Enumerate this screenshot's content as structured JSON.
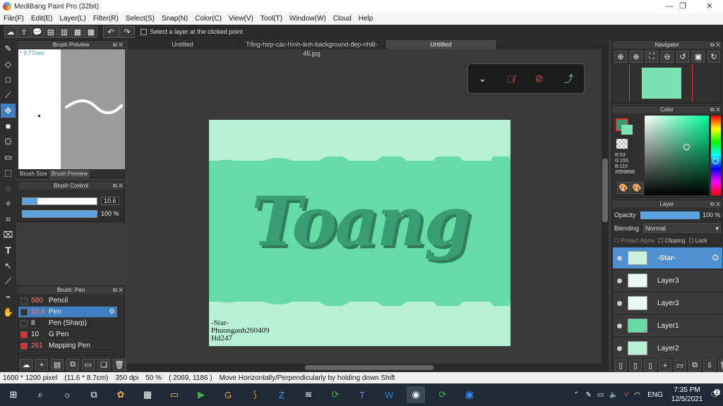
{
  "window": {
    "title": "MediBang Paint Pro (32bit)"
  },
  "menu": [
    "File(F)",
    "Edit(E)",
    "Layer(L)",
    "Filter(R)",
    "Select(S)",
    "Snap(N)",
    "Color(C)",
    "View(V)",
    "Tool(T)",
    "Window(W)",
    "Cloud",
    "Help"
  ],
  "toolbar": {
    "hint": "Select a layer at the clicked point"
  },
  "brush_preview": {
    "title": "Brush Preview",
    "size_label": "* 0.77mm",
    "tab_size": "Brush Size",
    "tab_preview": "Brush Preview"
  },
  "brush_control": {
    "title": "Brush Control",
    "size_value": "10.6",
    "opacity_value": "100 %",
    "size_fraction": 0.2,
    "opacity_fraction": 1.0
  },
  "tabs": [
    "Untitled",
    "Tổng-hợp-các-hình-ảnh-background-đẹp-nhất-45.jpg",
    "Untitled"
  ],
  "artwork": {
    "title": "Toang",
    "signature": [
      "-Star-",
      "Phuonganh260409",
      "Hd247"
    ]
  },
  "brush_list": {
    "title": "Brush: Pen",
    "items": [
      {
        "size": "580",
        "name": "Pencil",
        "swatch": "#333333",
        "highlight": false
      },
      {
        "size": "10.6",
        "name": "Pen",
        "swatch": "#333333",
        "highlight": true
      },
      {
        "size": "8",
        "name": "Pen (Sharp)",
        "swatch": "#333333",
        "highlight": false
      },
      {
        "size": "10",
        "name": "G Pen",
        "swatch": "#e03030",
        "highlight": false
      },
      {
        "size": "261",
        "name": "Mapping Pen",
        "swatch": "#e03030",
        "highlight": false
      }
    ]
  },
  "navigator": {
    "title": "Navigator"
  },
  "color_panel": {
    "title": "Color",
    "r": "R:53",
    "g": "G:155",
    "b": "B:110",
    "hex": "#359B6E",
    "current": "#359b6e"
  },
  "layer_panel": {
    "title": "Layer",
    "opacity_label": "Opacity",
    "opacity_value": "100 %",
    "blending_label": "Blending",
    "blending_value": "Normal",
    "protect_alpha": "Protect Alpha",
    "clipping": "Clipping",
    "lock": "Lock",
    "layers": [
      {
        "name": "-Star-",
        "active": true
      },
      {
        "name": "Layer3",
        "active": false
      },
      {
        "name": "Layer3",
        "active": false
      },
      {
        "name": "Layer1",
        "active": false
      },
      {
        "name": "Layer2",
        "active": false
      }
    ]
  },
  "status": {
    "size": "1600 * 1200 pixel",
    "cm": "(11.6 * 8.7cm)",
    "dpi": "350 dpi",
    "zoom": "50 %",
    "coords": "( 2069, 1186 )",
    "message": "Move Horizontally/Perpendicularly by holding down Shift"
  },
  "taskbar": {
    "lang": "ENG",
    "time": "7:35 PM",
    "date": "12/5/2021",
    "notifications": "2"
  }
}
